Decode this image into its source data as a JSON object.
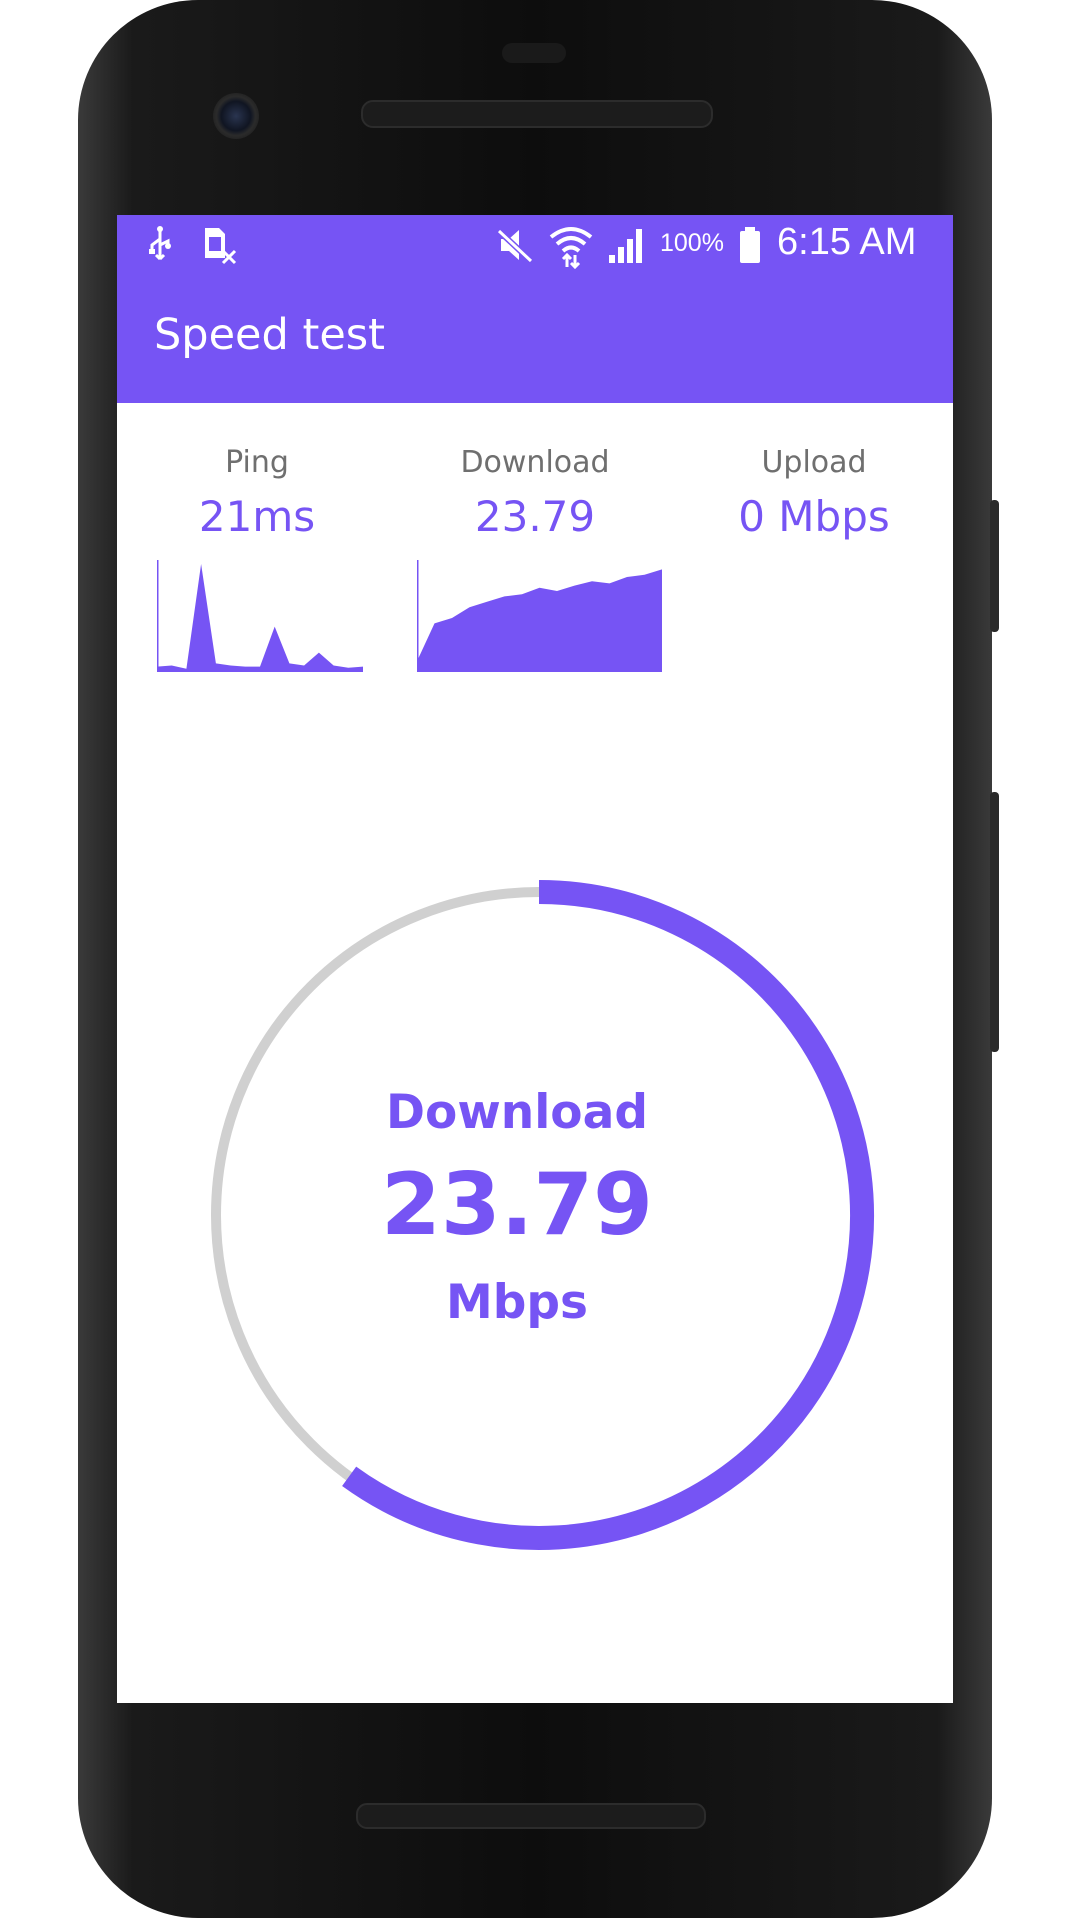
{
  "status_bar": {
    "battery": "100%",
    "time": "6:15 AM",
    "icons": [
      "usb-icon",
      "sim-card-error-icon",
      "mute-icon",
      "wifi-icon",
      "signal-icon",
      "battery-icon"
    ]
  },
  "app_bar": {
    "title": "Speed test"
  },
  "stats": {
    "ping": {
      "label": "Ping",
      "value": "21ms"
    },
    "download": {
      "label": "Download",
      "value": "23.79"
    },
    "upload": {
      "label": "Upload",
      "value": "0 Mbps"
    }
  },
  "gauge": {
    "label": "Download",
    "value": "23.79",
    "unit": "Mbps",
    "progress_fraction": 0.6
  },
  "chart_data": [
    {
      "type": "area",
      "series": [
        {
          "values": [
            0.05,
            0.06,
            0.03,
            1.0,
            0.08,
            0.06,
            0.05,
            0.05,
            0.42,
            0.08,
            0.06,
            0.18,
            0.06,
            0.04,
            0.05
          ]
        }
      ]
    },
    {
      "type": "area",
      "series": [
        {
          "values": [
            0.1,
            0.45,
            0.5,
            0.6,
            0.65,
            0.7,
            0.72,
            0.78,
            0.75,
            0.8,
            0.84,
            0.82,
            0.88,
            0.9,
            0.95
          ]
        }
      ]
    }
  ],
  "colors": {
    "accent": "#7654f4",
    "track": "#d0d0d0"
  }
}
